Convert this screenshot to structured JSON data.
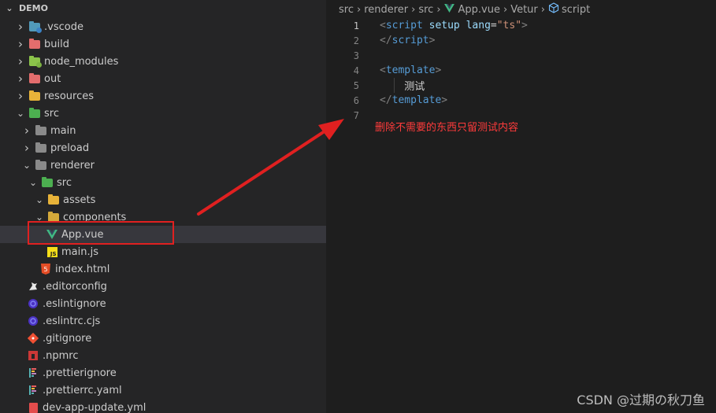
{
  "explorer": {
    "title": "DEMO",
    "items": [
      {
        "label": ".vscode",
        "icon": "vscode-folder-icon"
      },
      {
        "label": "build",
        "icon": "build-folder-icon"
      },
      {
        "label": "node_modules",
        "icon": "node-modules-folder-icon"
      },
      {
        "label": "out",
        "icon": "out-folder-icon"
      },
      {
        "label": "resources",
        "icon": "resources-folder-icon"
      },
      {
        "label": "src",
        "icon": "src-folder-icon"
      },
      {
        "label": "main",
        "icon": "folder-icon"
      },
      {
        "label": "preload",
        "icon": "folder-icon"
      },
      {
        "label": "renderer",
        "icon": "folder-open-icon"
      },
      {
        "label": "src",
        "icon": "src-folder-open-icon"
      },
      {
        "label": "assets",
        "icon": "assets-folder-icon"
      },
      {
        "label": "components",
        "icon": "components-folder-icon"
      },
      {
        "label": "App.vue",
        "icon": "vue-file-icon"
      },
      {
        "label": "main.js",
        "icon": "js-file-icon"
      },
      {
        "label": "index.html",
        "icon": "html-file-icon"
      },
      {
        "label": ".editorconfig",
        "icon": "editorconfig-icon"
      },
      {
        "label": ".eslintignore",
        "icon": "eslint-icon"
      },
      {
        "label": ".eslintrc.cjs",
        "icon": "eslint-icon"
      },
      {
        "label": ".gitignore",
        "icon": "git-icon"
      },
      {
        "label": ".npmrc",
        "icon": "npm-icon"
      },
      {
        "label": ".prettierignore",
        "icon": "prettier-icon"
      },
      {
        "label": ".prettierrc.yaml",
        "icon": "prettier-icon"
      },
      {
        "label": "dev-app-update.yml",
        "icon": "yaml-file-icon"
      }
    ]
  },
  "breadcrumb": {
    "items": [
      "src",
      "renderer",
      "src",
      "App.vue",
      "Vetur",
      "script"
    ]
  },
  "editor": {
    "lines": [
      {
        "num": "1",
        "parts": [
          [
            "punct",
            "<"
          ],
          [
            "tag",
            "script"
          ],
          [
            "txt",
            " "
          ],
          [
            "attr",
            "setup"
          ],
          [
            "txt",
            " "
          ],
          [
            "attr",
            "lang"
          ],
          [
            "txt",
            "="
          ],
          [
            "str",
            "\"ts\""
          ],
          [
            "punct",
            ">"
          ]
        ]
      },
      {
        "num": "2",
        "parts": [
          [
            "punct",
            "</"
          ],
          [
            "tag",
            "script"
          ],
          [
            "punct",
            ">"
          ]
        ]
      },
      {
        "num": "3",
        "parts": []
      },
      {
        "num": "4",
        "parts": [
          [
            "punct",
            "<"
          ],
          [
            "tag",
            "template"
          ],
          [
            "punct",
            ">"
          ]
        ]
      },
      {
        "num": "5",
        "parts": [
          [
            "txt",
            "    测试"
          ]
        ]
      },
      {
        "num": "6",
        "parts": [
          [
            "punct",
            "</"
          ],
          [
            "tag",
            "template"
          ],
          [
            "punct",
            ">"
          ]
        ]
      },
      {
        "num": "7",
        "parts": []
      }
    ]
  },
  "annotation": {
    "text": "删除不需要的东西只留测试内容"
  },
  "watermark": "CSDN @过期の秋刀鱼",
  "colors": {
    "annotation": "#e02020",
    "sidebar_bg": "#252526",
    "editor_bg": "#1e1e1e",
    "selected_row": "#37373d"
  }
}
